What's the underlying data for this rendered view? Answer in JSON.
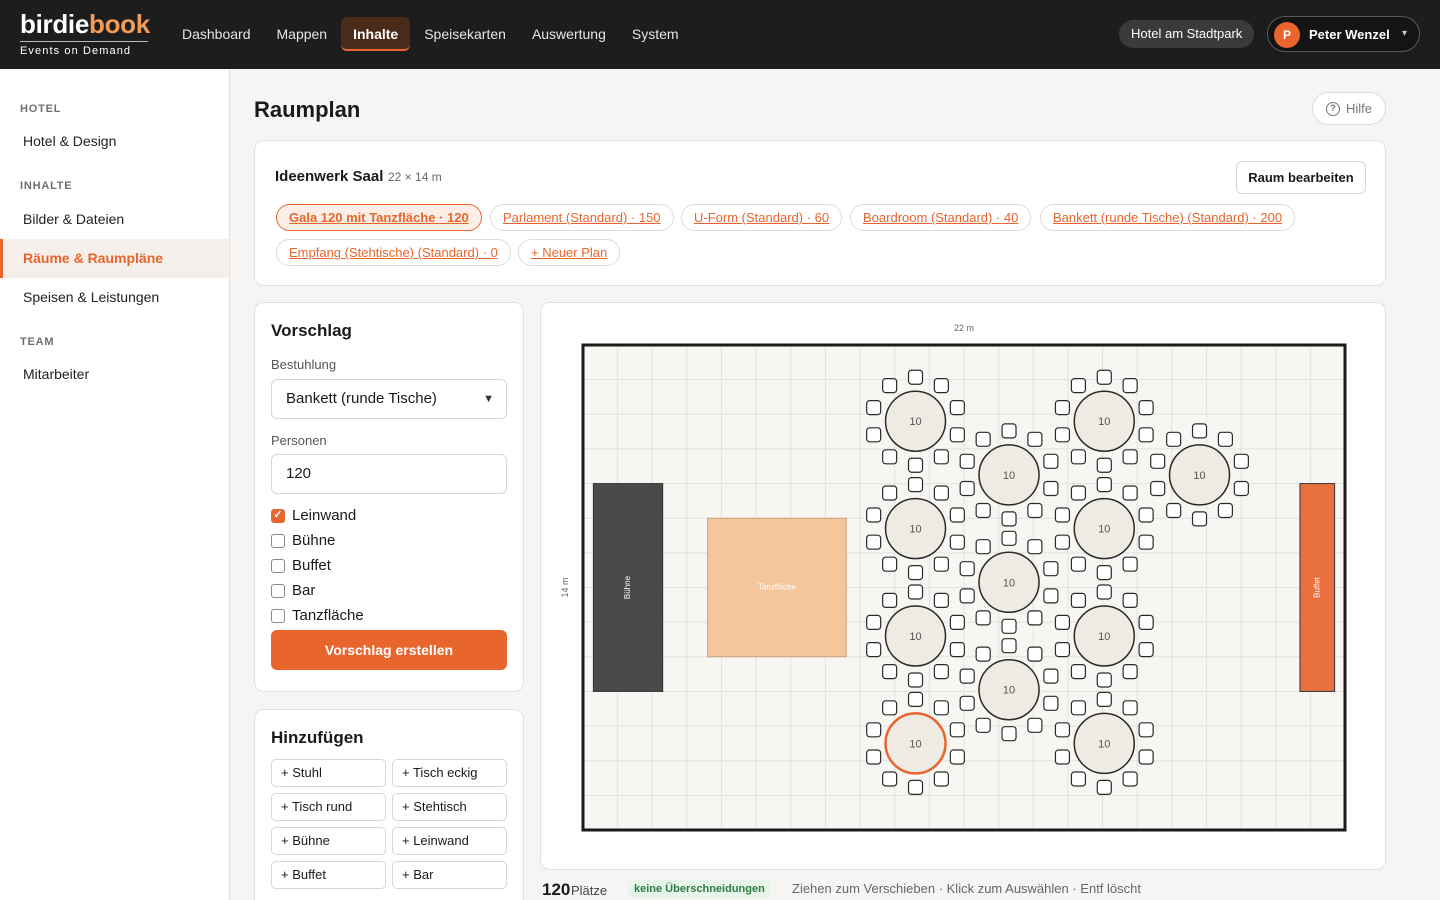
{
  "brand": {
    "word_part1": "birdie",
    "word_part2": "book",
    "tagline": "Events on Demand"
  },
  "nav": [
    {
      "label": "Dashboard",
      "active": false
    },
    {
      "label": "Mappen",
      "active": false
    },
    {
      "label": "Inhalte",
      "active": true
    },
    {
      "label": "Speisekarten",
      "active": false
    },
    {
      "label": "Auswertung",
      "active": false
    },
    {
      "label": "System",
      "active": false
    }
  ],
  "hotel_selector": "Hotel am Stadtpark",
  "user": {
    "initial": "P",
    "name": "Peter Wenzel",
    "caret": "▾"
  },
  "sidebar": {
    "sections": [
      {
        "title": "HOTEL",
        "items": [
          {
            "label": "Hotel & Design",
            "active": false
          }
        ]
      },
      {
        "title": "INHALTE",
        "items": [
          {
            "label": "Bilder & Dateien",
            "active": false
          },
          {
            "label": "Räume & Raumpläne",
            "active": true
          },
          {
            "label": "Speisen & Leistungen",
            "active": false
          }
        ]
      },
      {
        "title": "TEAM",
        "items": [
          {
            "label": "Mitarbeiter",
            "active": false
          }
        ]
      }
    ]
  },
  "page": {
    "title": "Raumplan",
    "help_label": "Hilfe",
    "help_icon": "question-circle-icon"
  },
  "room": {
    "name": "Ideenwerk Saal",
    "size": "22 × 14 m",
    "edit_label": "Raum bearbeiten",
    "plans": [
      {
        "label": "Gala 120 mit Tanzfläche · 120",
        "active": true
      },
      {
        "label": "Parlament (Standard) · 150",
        "active": false
      },
      {
        "label": "U-Form (Standard) · 60",
        "active": false
      },
      {
        "label": "Boardroom (Standard) · 40",
        "active": false
      },
      {
        "label": "Bankett (runde Tische) (Standard) · 200",
        "active": false
      },
      {
        "label": "Empfang (Stehtische) (Standard) · 0",
        "active": false
      },
      {
        "label": "+ Neuer Plan",
        "active": false
      }
    ]
  },
  "suggestion": {
    "title": "Vorschlag",
    "seating_label": "Bestuhlung",
    "seating_value": "Bankett (runde Tische)",
    "persons_label": "Personen",
    "persons_value": "120",
    "options": [
      {
        "label": "Leinwand",
        "checked": true
      },
      {
        "label": "Bühne",
        "checked": false
      },
      {
        "label": "Buffet",
        "checked": false
      },
      {
        "label": "Bar",
        "checked": false
      },
      {
        "label": "Tanzfläche",
        "checked": false
      }
    ],
    "submit_label": "Vorschlag erstellen"
  },
  "add": {
    "title": "Hinzufügen",
    "buttons": [
      "+ Stuhl",
      "+ Tisch eckig",
      "+ Tisch rund",
      "+ Stehtisch",
      "+ Bühne",
      "+ Leinwand",
      "+ Buffet",
      "+ Bar"
    ]
  },
  "floorplan": {
    "width_label": "22 m",
    "height_label": "14 m",
    "room_m": [
      22,
      14
    ],
    "elements": [
      {
        "type": "stage",
        "label": "Bühne",
        "color": "#4a4a4a",
        "x_m": 0.3,
        "y_m": 4.0,
        "w_m": 2.0,
        "h_m": 6.0
      },
      {
        "type": "dancefloor",
        "label": "Tanzfläche",
        "color": "#f5c59c",
        "x_m": 3.6,
        "y_m": 5.0,
        "w_m": 4.0,
        "h_m": 4.0
      },
      {
        "type": "buffet",
        "label": "Buffet",
        "color": "#e8703e",
        "x_m": 20.7,
        "y_m": 4.0,
        "w_m": 1.0,
        "h_m": 6.0
      }
    ],
    "tables": [
      {
        "seats": "10",
        "x_m": 9.6,
        "y_m": 2.2,
        "selected": false
      },
      {
        "seats": "10",
        "x_m": 9.6,
        "y_m": 5.3,
        "selected": false
      },
      {
        "seats": "10",
        "x_m": 9.6,
        "y_m": 8.4,
        "selected": false
      },
      {
        "seats": "10",
        "x_m": 9.6,
        "y_m": 11.5,
        "selected": true
      },
      {
        "seats": "10",
        "x_m": 12.3,
        "y_m": 3.75,
        "selected": false
      },
      {
        "seats": "10",
        "x_m": 12.3,
        "y_m": 6.85,
        "selected": false
      },
      {
        "seats": "10",
        "x_m": 12.3,
        "y_m": 9.95,
        "selected": false
      },
      {
        "seats": "10",
        "x_m": 15.05,
        "y_m": 2.2,
        "selected": false
      },
      {
        "seats": "10",
        "x_m": 15.05,
        "y_m": 5.3,
        "selected": false
      },
      {
        "seats": "10",
        "x_m": 15.05,
        "y_m": 8.4,
        "selected": false
      },
      {
        "seats": "10",
        "x_m": 15.05,
        "y_m": 11.5,
        "selected": false
      },
      {
        "seats": "10",
        "x_m": 17.8,
        "y_m": 3.75,
        "selected": false
      }
    ]
  },
  "status": {
    "seats": "120",
    "seats_label": "Plätze",
    "collision_badge": "keine Überschneidungen",
    "hint": "Ziehen zum Verschieben · Klick zum Auswählen · Entf löscht"
  },
  "colors": {
    "accent": "#e8652e",
    "topbar": "#1d1d1d",
    "ok": "#2e7d43"
  }
}
